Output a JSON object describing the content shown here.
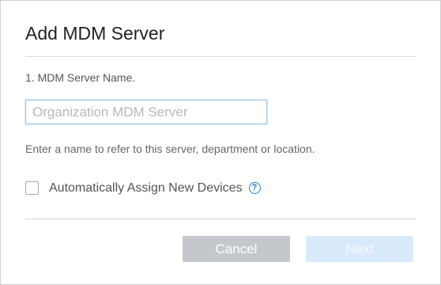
{
  "dialog": {
    "title": "Add MDM Server",
    "step_label": "1. MDM Server Name.",
    "name_input": {
      "value": "",
      "placeholder": "Organization MDM Server"
    },
    "hint": "Enter a name to refer to this server, department or location.",
    "auto_assign": {
      "label": "Automatically Assign New Devices",
      "checked": false,
      "help_icon": "question-circle-icon",
      "help_glyph": "?"
    },
    "buttons": {
      "cancel": "Cancel",
      "next": "Next"
    }
  },
  "colors": {
    "accent": "#1f7fd3",
    "cancel_bg": "#c4c8cd",
    "next_disabled_bg": "#d9eafb"
  }
}
